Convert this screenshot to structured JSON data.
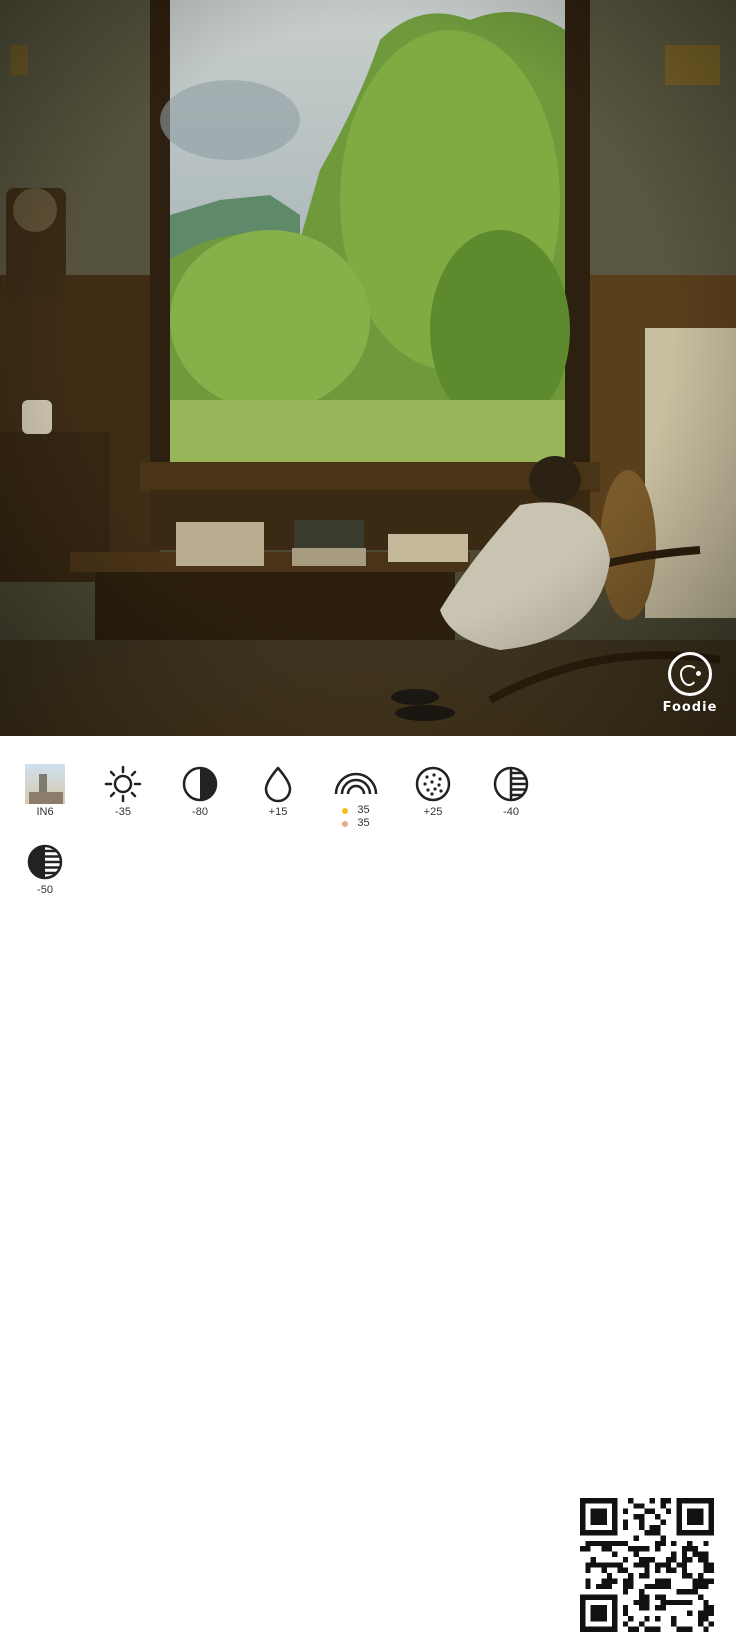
{
  "app": {
    "watermark": "Foodie"
  },
  "photo": {
    "description_icon": "photo-scene",
    "colors": {
      "wall": "#4a4732",
      "window_frame": "#3b2a14",
      "sky": "#b9c2c4",
      "trees": "#7aa040",
      "floor": "#3a2d18"
    }
  },
  "adjustments": [
    {
      "icon": "filter-thumbnail",
      "value": "IN6"
    },
    {
      "icon": "brightness-icon",
      "value": "-35"
    },
    {
      "icon": "contrast-icon",
      "value": "-80"
    },
    {
      "icon": "saturation-icon",
      "value": "+15"
    },
    {
      "icon": "color-tone-icon",
      "tones": [
        {
          "color": "#f0c020",
          "value": "35"
        },
        {
          "color": "#e8a880",
          "value": "35"
        }
      ]
    },
    {
      "icon": "grain-icon",
      "value": "+25"
    },
    {
      "icon": "highlights-icon",
      "value": "-40"
    },
    {
      "icon": "shadows-icon",
      "value": "-50"
    }
  ],
  "qr_code": {
    "icon": "qr-code"
  }
}
